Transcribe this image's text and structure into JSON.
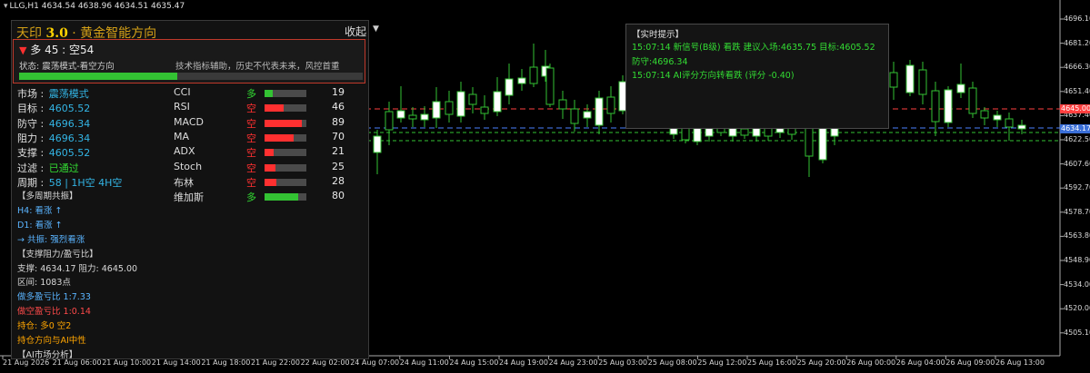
{
  "window": {
    "title": "LLG,H1  4634.54 4638.96 4634.51 4635.47"
  },
  "panel": {
    "title_prefix": "天印 ",
    "title_version": "3.0",
    "title_suffix": " · 黄金智能方向",
    "collapse_label": "收起",
    "collapse_arrow": "▼",
    "signal": {
      "arrow": "▼",
      "text": " 多 45 : 空54",
      "status": "状态: 震荡模式-看空方向",
      "note": "技术指标辅助，历史不代表未来，风控首重",
      "strength": 0.46
    },
    "rows": [
      {
        "label": "市场 : ",
        "value": "震荡模式",
        "color": "#33b5e5"
      },
      {
        "label": "目标 : ",
        "value": "4605.52",
        "color": "#33b5e5"
      },
      {
        "label": "防守 : ",
        "value": "4696.34",
        "color": "#33b5e5"
      },
      {
        "label": "阻力 : ",
        "value": "4696.34",
        "color": "#33b5e5"
      },
      {
        "label": "支撑 : ",
        "value": "4605.52",
        "color": "#33b5e5"
      },
      {
        "label": "过滤 : ",
        "value": "已通过",
        "color": "#33dd33"
      },
      {
        "label": "周期 : ",
        "value": "58 | 1H空 4H空",
        "color": "#33b5e5"
      }
    ],
    "indicators": [
      {
        "name": "CCI",
        "dir": "多",
        "dir_color": "#33dd33",
        "value": "19",
        "fill": 0.19,
        "fill_color": "#33c233"
      },
      {
        "name": "RSI",
        "dir": "空",
        "dir_color": "#ff3030",
        "value": "46",
        "fill": 0.46,
        "fill_color": "#ff3030"
      },
      {
        "name": "MACD",
        "dir": "空",
        "dir_color": "#ff3030",
        "value": "89",
        "fill": 0.89,
        "fill_color": "#ff3030"
      },
      {
        "name": "MA",
        "dir": "空",
        "dir_color": "#ff3030",
        "value": "70",
        "fill": 0.7,
        "fill_color": "#ff3030"
      },
      {
        "name": "ADX",
        "dir": "空",
        "dir_color": "#ff3030",
        "value": "21",
        "fill": 0.21,
        "fill_color": "#ff3030"
      },
      {
        "name": "Stoch",
        "dir": "空",
        "dir_color": "#ff3030",
        "value": "25",
        "fill": 0.25,
        "fill_color": "#ff3030"
      },
      {
        "name": "布林",
        "dir": "空",
        "dir_color": "#ff3030",
        "value": "28",
        "fill": 0.28,
        "fill_color": "#ff3030"
      },
      {
        "name": "维加斯",
        "dir": "多",
        "dir_color": "#33dd33",
        "value": "80",
        "fill": 0.8,
        "fill_color": "#33c233"
      }
    ],
    "lines": [
      {
        "text": "【多周期共振】",
        "color": "#d8d8d8"
      },
      {
        "text": "H4: 看涨 ↑",
        "color": "#5ab4ff"
      },
      {
        "text": "D1: 看涨 ↑",
        "color": "#5ab4ff"
      },
      {
        "text": "→ 共振: 强烈看涨",
        "color": "#5ab4ff"
      },
      {
        "text": "【支撑阻力/盈亏比】",
        "color": "#d8d8d8"
      },
      {
        "text": "支撑: 4634.17 阻力: 4645.00",
        "color": "#d8d8d8"
      },
      {
        "text": "区间: 1083点",
        "color": "#d8d8d8"
      },
      {
        "text": "做多盈亏比 1:7.33",
        "color": "#5ab4ff"
      },
      {
        "text": "做空盈亏比 1:0.14",
        "color": "#ff4a4a"
      },
      {
        "text": "持仓: 多0 空2",
        "color": "#ffa500"
      },
      {
        "text": "持仓方向与AI中性",
        "color": "#ffa500"
      },
      {
        "text": "【AI市场分析】",
        "color": "#d8d8d8"
      }
    ]
  },
  "realtime": {
    "title": "【实时提示】",
    "line1": "15:07:14 新信号(B级) 看跌 建议入场:4635.75 目标:4605.52",
    "line2": "防守:4696.34",
    "line3": "15:07:14 AI评分方向转看跌 (评分 -0.40)"
  },
  "price_axis": {
    "labels": [
      "4696.10",
      "4681.20",
      "4666.30",
      "4651.40",
      "4637.40",
      "4622.50",
      "4607.60",
      "4592.70",
      "4578.70",
      "4563.80",
      "4548.90",
      "4534.00",
      "4520.00",
      "4505.10"
    ],
    "resistance_tag": "4645.00",
    "current_tag": "4634.17"
  },
  "time_axis": {
    "labels": [
      "21 Aug 2026",
      "21 Aug 06:00",
      "21 Aug 10:00",
      "21 Aug 14:00",
      "21 Aug 18:00",
      "21 Aug 22:00",
      "22 Aug 02:00",
      "24 Aug 07:00",
      "24 Aug 11:00",
      "24 Aug 15:00",
      "24 Aug 19:00",
      "24 Aug 23:00",
      "25 Aug 03:00",
      "25 Aug 08:00",
      "25 Aug 12:00",
      "25 Aug 16:00",
      "25 Aug 20:00",
      "26 Aug 00:00",
      "26 Aug 04:00",
      "26 Aug 09:00",
      "26 Aug 13:00"
    ]
  },
  "colors": {
    "bull": "#ffffff",
    "bear": "#000000",
    "wick": "#33c233",
    "resistance": "#ff4040",
    "support": "#4a7fff",
    "dash": "#33c233"
  }
}
